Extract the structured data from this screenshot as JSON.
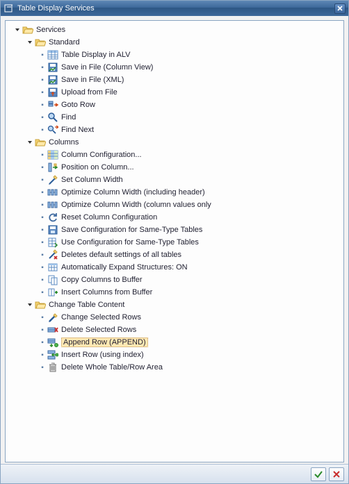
{
  "window": {
    "title": "Table Display Services"
  },
  "tree": [
    {
      "depth": 0,
      "expander": true,
      "icon": "folder-open-icon",
      "name": "services-node",
      "label": "Services"
    },
    {
      "depth": 1,
      "expander": true,
      "icon": "folder-open-icon",
      "name": "standard-node",
      "label": "Standard"
    },
    {
      "depth": 2,
      "bullet": true,
      "icon": "table-alv-icon",
      "name": "table-display-alv-item",
      "label": "Table Display in ALV"
    },
    {
      "depth": 2,
      "bullet": true,
      "icon": "save-file-icon",
      "name": "save-in-file-column-item",
      "label": "Save in File (Column View)"
    },
    {
      "depth": 2,
      "bullet": true,
      "icon": "save-file-icon",
      "name": "save-in-file-xml-item",
      "label": "Save in File (XML)"
    },
    {
      "depth": 2,
      "bullet": true,
      "icon": "upload-icon",
      "name": "upload-from-file-item",
      "label": "Upload from File"
    },
    {
      "depth": 2,
      "bullet": true,
      "icon": "goto-row-icon",
      "name": "goto-row-item",
      "label": "Goto Row"
    },
    {
      "depth": 2,
      "bullet": true,
      "icon": "find-icon",
      "name": "find-item",
      "label": "Find"
    },
    {
      "depth": 2,
      "bullet": true,
      "icon": "find-next-icon",
      "name": "find-next-item",
      "label": "Find Next"
    },
    {
      "depth": 1,
      "expander": true,
      "icon": "folder-open-icon",
      "name": "columns-node",
      "label": "Columns"
    },
    {
      "depth": 2,
      "bullet": true,
      "icon": "columns-config-icon",
      "name": "column-configuration-item",
      "label": "Column Configuration..."
    },
    {
      "depth": 2,
      "bullet": true,
      "icon": "position-column-icon",
      "name": "position-on-column-item",
      "label": "Position on Column..."
    },
    {
      "depth": 2,
      "bullet": true,
      "icon": "set-width-icon",
      "name": "set-column-width-item",
      "label": "Set Column Width"
    },
    {
      "depth": 2,
      "bullet": true,
      "icon": "optimize-width-icon",
      "name": "optimize-width-header-item",
      "label": "Optimize Column Width (including header)"
    },
    {
      "depth": 2,
      "bullet": true,
      "icon": "optimize-width-icon",
      "name": "optimize-width-values-item",
      "label": "Optimize Column Width (column values only"
    },
    {
      "depth": 2,
      "bullet": true,
      "icon": "reset-config-icon",
      "name": "reset-column-config-item",
      "label": "Reset Column Configuration"
    },
    {
      "depth": 2,
      "bullet": true,
      "icon": "save-config-icon",
      "name": "save-config-same-type-item",
      "label": "Save Configuration for Same-Type Tables"
    },
    {
      "depth": 2,
      "bullet": true,
      "icon": "use-config-icon",
      "name": "use-config-same-type-item",
      "label": "Use Configuration for Same-Type Tables"
    },
    {
      "depth": 2,
      "bullet": true,
      "icon": "delete-settings-icon",
      "name": "delete-defaults-item",
      "label": "Deletes default settings of all tables"
    },
    {
      "depth": 2,
      "bullet": true,
      "icon": "expand-struct-icon",
      "name": "auto-expand-item",
      "label": "Automatically Expand Structures: ON"
    },
    {
      "depth": 2,
      "bullet": true,
      "icon": "copy-columns-icon",
      "name": "copy-columns-buffer-item",
      "label": "Copy Columns to Buffer"
    },
    {
      "depth": 2,
      "bullet": true,
      "icon": "insert-columns-icon",
      "name": "insert-columns-buffer-item",
      "label": "Insert Columns from Buffer"
    },
    {
      "depth": 1,
      "expander": true,
      "icon": "folder-open-icon",
      "name": "change-table-node",
      "label": "Change Table Content"
    },
    {
      "depth": 2,
      "bullet": true,
      "icon": "pencil-icon",
      "name": "change-selected-rows-item",
      "label": "Change Selected Rows"
    },
    {
      "depth": 2,
      "bullet": true,
      "icon": "delete-row-icon",
      "name": "delete-selected-rows-item",
      "label": "Delete Selected Rows"
    },
    {
      "depth": 2,
      "bullet": true,
      "icon": "append-row-icon",
      "name": "append-row-item",
      "label": "Append Row (APPEND)",
      "selected": true
    },
    {
      "depth": 2,
      "bullet": true,
      "icon": "insert-row-icon",
      "name": "insert-row-item",
      "label": "Insert Row (using index)"
    },
    {
      "depth": 2,
      "bullet": true,
      "icon": "delete-table-icon",
      "name": "delete-whole-table-item",
      "label": "Delete Whole Table/Row Area"
    }
  ]
}
